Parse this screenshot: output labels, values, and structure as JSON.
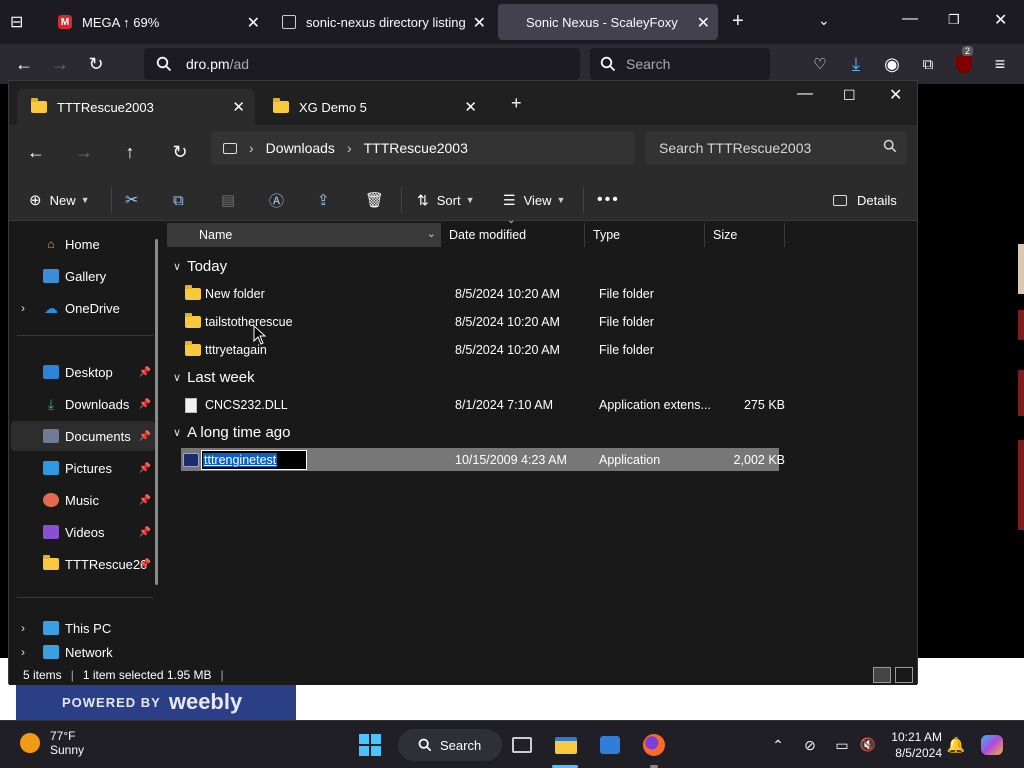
{
  "browser": {
    "tabs": [
      {
        "label": "MEGA ↑ 69%",
        "icon": "mega-icon"
      },
      {
        "label": "sonic-nexus directory listing",
        "icon": "document-icon"
      },
      {
        "label": "Sonic Nexus - ScaleyFoxy",
        "icon": "none",
        "active": true
      }
    ],
    "url_host": "dro.pm",
    "url_path": "/ad",
    "search_placeholder": "Search",
    "extension_badge": "2"
  },
  "page": {
    "powered_by": "POWERED BY",
    "brand": "weebly"
  },
  "explorer": {
    "tabs": [
      {
        "label": "TTTRescue2003",
        "active": true
      },
      {
        "label": "XG Demo 5"
      }
    ],
    "breadcrumb": [
      "Downloads",
      "TTTRescue2003"
    ],
    "search_placeholder": "Search TTTRescue2003",
    "toolbar": {
      "new_label": "New",
      "sort_label": "Sort",
      "view_label": "View",
      "details_label": "Details"
    },
    "sidebar": {
      "home": "Home",
      "gallery": "Gallery",
      "onedrive": "OneDrive",
      "desktop": "Desktop",
      "downloads": "Downloads",
      "documents": "Documents",
      "pictures": "Pictures",
      "music": "Music",
      "videos": "Videos",
      "tttrescue": "TTTRescue20",
      "thispc": "This PC",
      "network": "Network"
    },
    "columns": {
      "name": "Name",
      "date": "Date modified",
      "type": "Type",
      "size": "Size"
    },
    "groups": {
      "today": {
        "label": "Today",
        "rows": [
          {
            "name": "New folder",
            "date": "8/5/2024 10:20 AM",
            "type": "File folder",
            "size": ""
          },
          {
            "name": "tailstotherescue",
            "date": "8/5/2024 10:20 AM",
            "type": "File folder",
            "size": ""
          },
          {
            "name": "tttryetagain",
            "date": "8/5/2024 10:20 AM",
            "type": "File folder",
            "size": ""
          }
        ]
      },
      "last_week": {
        "label": "Last week",
        "rows": [
          {
            "name": "CNCS232.DLL",
            "date": "8/1/2024 7:10 AM",
            "type": "Application extens...",
            "size": "275 KB"
          }
        ]
      },
      "long_ago": {
        "label": "A long time ago",
        "rows": [
          {
            "name": "tttrenginetest",
            "date": "10/15/2009 4:23 AM",
            "type": "Application",
            "size": "2,002 KB"
          }
        ]
      }
    },
    "status": {
      "count": "5 items",
      "selection": "1 item selected  1.95 MB"
    }
  },
  "taskbar": {
    "temp": "77°F",
    "condition": "Sunny",
    "search_label": "Search",
    "time": "10:21 AM",
    "date": "8/5/2024"
  }
}
